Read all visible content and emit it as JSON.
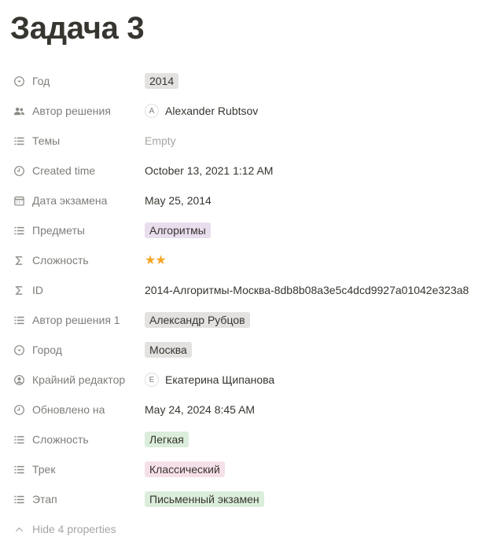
{
  "page": {
    "title": "Задача 3"
  },
  "properties": {
    "year": {
      "label": "Год",
      "value": "2014",
      "icon": "select-icon"
    },
    "solution_author": {
      "label": "Автор решения",
      "avatar_letter": "A",
      "value": "Alexander Rubtsov",
      "icon": "people-icon"
    },
    "topics": {
      "label": "Темы",
      "value": "Empty",
      "icon": "list-icon"
    },
    "created_time": {
      "label": "Created time",
      "value": "October 13, 2021 1:12 AM",
      "icon": "clock-icon"
    },
    "exam_date": {
      "label": "Дата экзамена",
      "value": "May 25, 2014",
      "icon": "calendar-icon"
    },
    "subjects": {
      "label": "Предметы",
      "value": "Алгоритмы",
      "icon": "list-icon"
    },
    "difficulty_formula": {
      "label": "Сложность",
      "stars": "★★",
      "rating": 2,
      "icon": "sigma-icon"
    },
    "id": {
      "label": "ID",
      "value": "2014-Алгоритмы-Москва-8db8b08a3e5c4dcd9927a01042e323a8",
      "icon": "sigma-icon"
    },
    "solution_author_1": {
      "label": "Автор решения 1",
      "value": "Александр Рубцов",
      "icon": "list-icon"
    },
    "city": {
      "label": "Город",
      "value": "Москва",
      "icon": "select-icon"
    },
    "last_editor": {
      "label": "Крайний редактор",
      "avatar_letter": "E",
      "value": "Екатерина Щипанова",
      "icon": "person-icon"
    },
    "updated_at": {
      "label": "Обновлено на",
      "value": "May 24, 2024 8:45 AM",
      "icon": "clock-icon"
    },
    "difficulty": {
      "label": "Сложность",
      "value": "Легкая",
      "icon": "list-icon"
    },
    "track": {
      "label": "Трек",
      "value": "Классический",
      "icon": "list-icon"
    },
    "stage": {
      "label": "Этап",
      "value": "Письменный экзамен",
      "icon": "list-icon"
    }
  },
  "hide_properties": {
    "label": "Hide 4 properties",
    "icon": "chevron-up-icon"
  },
  "colors": {
    "tag_gray": "#e3e2e0",
    "tag_purple": "#e8deee",
    "tag_green": "#dbeddb",
    "tag_pink": "#f5e0e9",
    "star": "#f5a623"
  }
}
